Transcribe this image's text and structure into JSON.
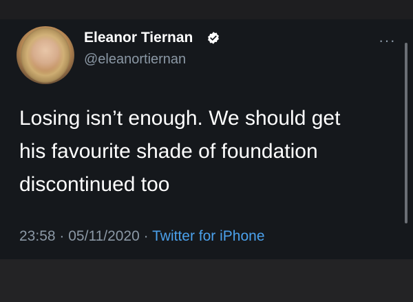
{
  "tweet": {
    "author_name": "Eleanor Tiernan",
    "author_handle": "@eleanortiernan",
    "text_lines": [
      "Losing isn’t enough. We should get",
      "his favourite shade of foundation",
      "discontinued too"
    ],
    "time": "23:58",
    "date": "05/11/2020",
    "separator": "·",
    "source": "Twitter for iPhone",
    "more_label": "···"
  },
  "colors": {
    "background": "#15181c",
    "secondary_text": "#8b98a5",
    "link": "#4ba1ec",
    "verified_badge": "#ffffff"
  },
  "icons": {
    "verified": "verified-badge-icon",
    "more": "more-options-icon"
  }
}
